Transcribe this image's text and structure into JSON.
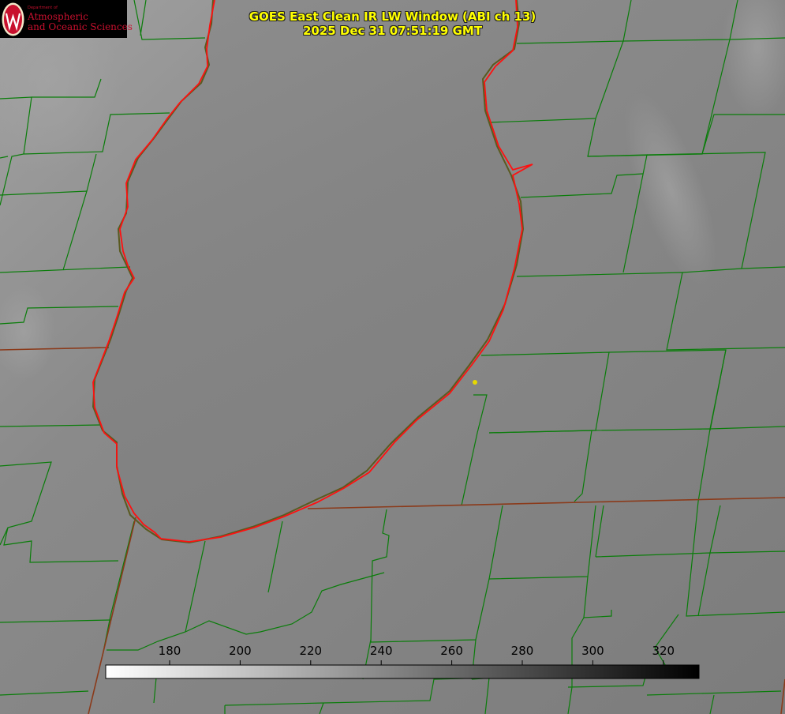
{
  "title": {
    "line1": "GOES East Clean IR LW Window (ABI ch 13)",
    "line2": "2025 Dec 31 07:51:19 GMT"
  },
  "logo": {
    "dept_small": "Department of",
    "line1": "Atmospheric",
    "line2": "and Oceanic Sciences",
    "seal_letter": "W"
  },
  "colorbar": {
    "ticks": [
      "180",
      "200",
      "220",
      "240",
      "260",
      "280",
      "300",
      "320"
    ],
    "gradient_from": "#ffffff",
    "gradient_to": "#000000"
  },
  "colors": {
    "lake_outline": "#ff0000",
    "county_lines": "#008000",
    "state_lines": "#8b4513",
    "point_marker": "#e6d800",
    "title_text": "#ffff00",
    "logo_red": "#c8102e"
  }
}
